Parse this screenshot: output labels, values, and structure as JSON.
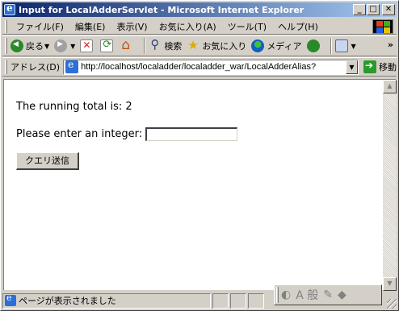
{
  "window": {
    "title": "Input for LocalAdderServlet - Microsoft Internet Explorer",
    "controls": {
      "minimize": "_",
      "maximize": "□",
      "close": "✕"
    }
  },
  "menu": {
    "items": [
      "ファイル(F)",
      "編集(E)",
      "表示(V)",
      "お気に入り(A)",
      "ツール(T)",
      "ヘルプ(H)"
    ]
  },
  "toolbar": {
    "back_label": "戻る",
    "search_label": "検索",
    "favorites_label": "お気に入り",
    "media_label": "メディア",
    "overflow": "»"
  },
  "address": {
    "label": "アドレス(D)",
    "url": "http://localhost/localadder/localadder_war/LocalAdderAlias?",
    "go_label": "移動"
  },
  "page": {
    "total_text": "The running total is: 2",
    "prompt_text": "Please enter an integer:",
    "input_value": "",
    "submit_label": "クエリ送信"
  },
  "status": {
    "text": "ページが表示されました"
  },
  "ime": {
    "mode_text": "A 般"
  },
  "colors": {
    "titlebar_start": "#0a246a",
    "titlebar_end": "#a6caf0",
    "chrome": "#d4d0c8"
  }
}
